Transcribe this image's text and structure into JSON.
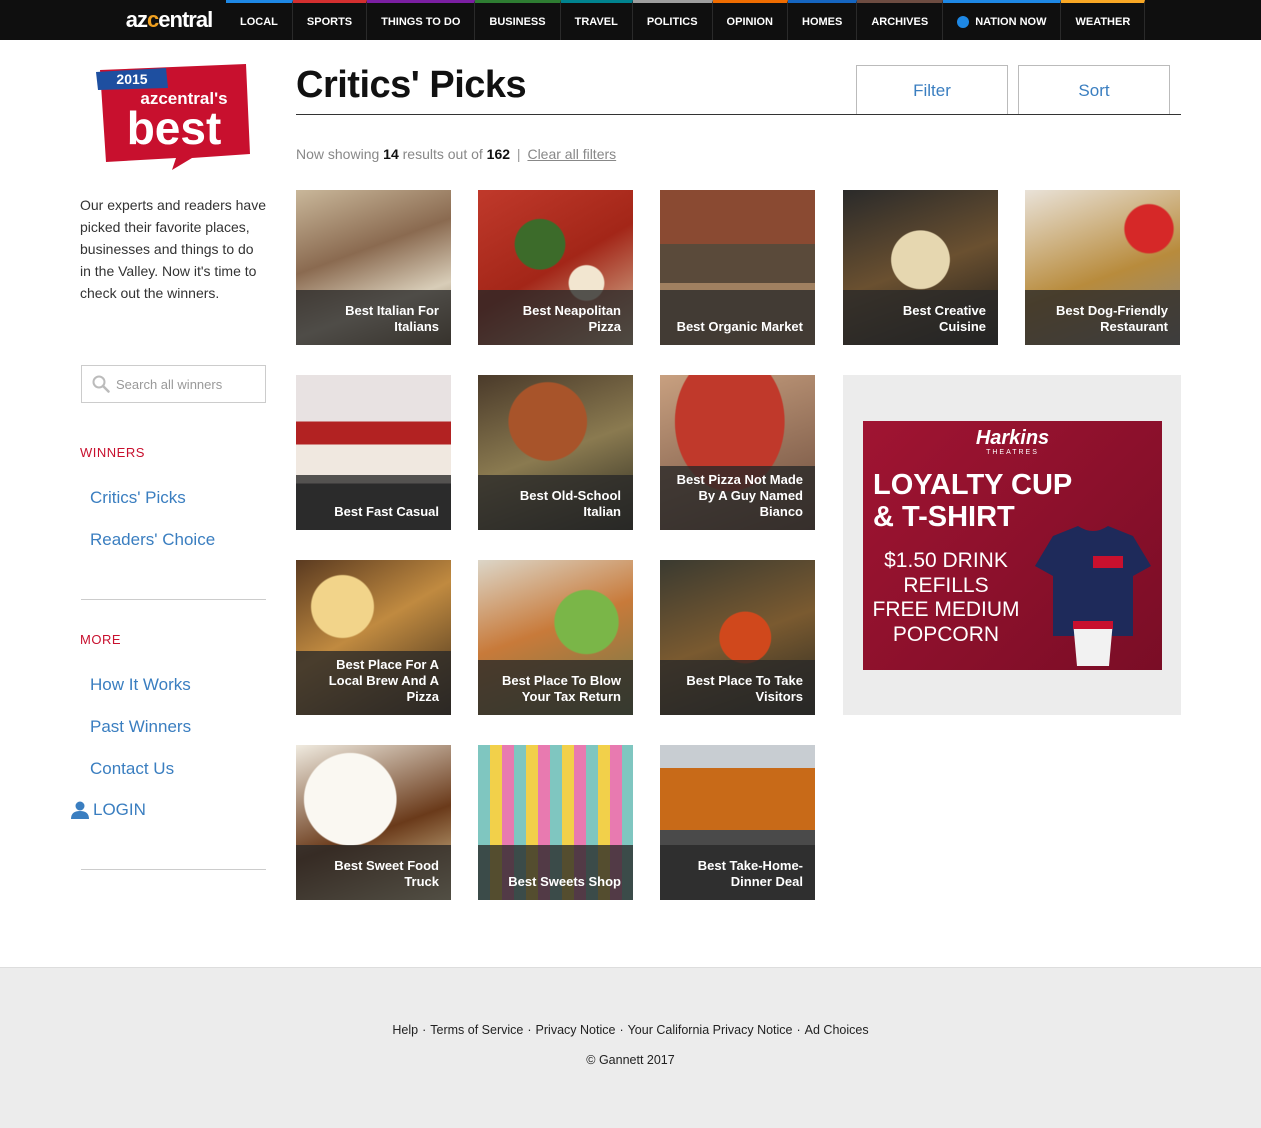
{
  "nav": {
    "brand": {
      "pre": "az",
      "mid": "c",
      "post": "entral"
    },
    "items": [
      {
        "label": "LOCAL",
        "color": "#1e88e5"
      },
      {
        "label": "SPORTS",
        "color": "#d32f2f"
      },
      {
        "label": "THINGS TO DO",
        "color": "#7b1fa2"
      },
      {
        "label": "BUSINESS",
        "color": "#2e7d32"
      },
      {
        "label": "TRAVEL",
        "color": "#00838f"
      },
      {
        "label": "POLITICS",
        "color": "#9e9e9e"
      },
      {
        "label": "OPINION",
        "color": "#ef6c00"
      },
      {
        "label": "HOMES",
        "color": "#1565c0"
      },
      {
        "label": "ARCHIVES",
        "color": "#6d4c41"
      },
      {
        "label": "NATION NOW",
        "color": "#1e88e5"
      },
      {
        "label": "WEATHER",
        "color": "#f9a825"
      }
    ]
  },
  "sidebar": {
    "logo": {
      "year": "2015",
      "brand": "azcentral's",
      "word": "best"
    },
    "intro": "Our experts and readers have picked their favorite places, businesses and things to do in the Valley. Now it's time to check out the winners.",
    "search_placeholder": "Search all winners",
    "winners_heading": "WINNERS",
    "winners_links": [
      "Critics' Picks",
      "Readers' Choice"
    ],
    "more_heading": "MORE",
    "more_links": [
      "How It Works",
      "Past Winners",
      "Contact Us"
    ],
    "login": "LOGIN"
  },
  "main": {
    "title": "Critics' Picks",
    "filter_label": "Filter",
    "sort_label": "Sort",
    "status": {
      "prefix": "Now showing",
      "shown": "14",
      "middle": "results out of",
      "total": "162",
      "separator": "|",
      "clear": "Clear all filters"
    },
    "tiles": [
      {
        "caption": "Best Italian For Italians",
        "bg": "linear-gradient(160deg,#c9b79a,#8a6a50 40%,#d8cdb8 70%,#6d5a40)"
      },
      {
        "caption": "Best Neapolitan Pizza",
        "bg": "radial-gradient(circle at 40% 35%,#3c6b2a 0 18%,transparent 19%),radial-gradient(circle at 70% 60%,#f2e6d0 0 12%,transparent 13%),linear-gradient(150deg,#c0392b,#a32618 50%,#d8c4a0)"
      },
      {
        "caption": "Best Organic Market",
        "bg": "linear-gradient(180deg,#8a4a32 0 35%,#5a4a3a 35% 60%,#a08060 60%)"
      },
      {
        "caption": "Best Creative Cuisine",
        "bg": "radial-gradient(circle at 50% 45%,#e6d7b0 0 25%,transparent 26%),linear-gradient(160deg,#2a2a2a,#6a5030 50%,#1a1a1a)"
      },
      {
        "caption": "Best Dog-Friendly Restaurant",
        "bg": "radial-gradient(circle at 80% 25%,#d62828 0 14%,transparent 15%),linear-gradient(160deg,#e9e2d8,#b88b3c 55%,#8a8a8a)"
      },
      {
        "caption": "Best Fast Casual",
        "bg": "linear-gradient(180deg,#e8e2e2 0 30%,#b22222 30% 45%,#f0e8e0 45% 70%,#3a3a3a 70%)"
      },
      {
        "caption": "Best Old-School Italian",
        "bg": "radial-gradient(circle at 45% 30%,#a8542a 0 28%,transparent 29%),linear-gradient(160deg,#4a3a2a,#8a7a50 50%,#2a2a20)"
      },
      {
        "caption": "Best Pizza Not Made By A Guy Named Bianco",
        "bg": "radial-gradient(ellipse at 45% 30%,#c0392b 0 45%,transparent 46%),linear-gradient(160deg,#c8a080,#6a4a3a)"
      },
      {
        "caption": "Best Place For A Local Brew And A Pizza",
        "bg": "radial-gradient(circle at 30% 30%,#f2d48a 0 20%,transparent 21%),linear-gradient(150deg,#5a3a20,#c08a40 45%,#3a2a1a)"
      },
      {
        "caption": "Best Place To Blow Your Tax Return",
        "bg": "radial-gradient(circle at 70% 40%,#7ab648 0 22%,transparent 23%),linear-gradient(160deg,#dcd6c8,#c87a3a 45%,#6a7a4a)"
      },
      {
        "caption": "Best Place To Take Visitors",
        "bg": "radial-gradient(circle at 55% 50%,#d0481c 0 22%,transparent 23%),linear-gradient(160deg,#3a3a30,#7a5a30 50%,#2a2a22)"
      },
      {
        "caption": "Best Sweet Food Truck",
        "bg": "radial-gradient(circle at 35% 35%,#faf8f2 0 32%,transparent 33%),linear-gradient(160deg,#f0ebe0,#6a3a1a 55%,#e6d8a8)"
      },
      {
        "caption": "Best Sweets Shop",
        "bg": "repeating-linear-gradient(90deg,#7fc6c0 0 12px,#f2d04a 12px 24px,#e87ab0 24px 36px)"
      },
      {
        "caption": "Best Take-Home-Dinner Deal",
        "bg": "linear-gradient(180deg,#c8cdd2 0 15%,#c86a18 15% 55%,#4a4a4a 55%)"
      }
    ],
    "ad": {
      "brand": "Harkins",
      "subbrand": "THEATRES",
      "headline1": "LOYALTY CUP",
      "headline2": "& T-SHIRT",
      "offer1": "$1.50 DRINK",
      "offer2": "REFILLS",
      "offer3": "FREE MEDIUM",
      "offer4": "POPCORN"
    }
  },
  "footer": {
    "links": [
      "Help",
      "Terms of Service",
      "Privacy Notice",
      "Your California Privacy Notice",
      "Ad Choices"
    ],
    "copyright": "© Gannett 2017"
  },
  "colors": {
    "accent_red": "#c8102e",
    "link_blue": "#3a7ec0",
    "nav_bg": "#0f0f0f"
  }
}
